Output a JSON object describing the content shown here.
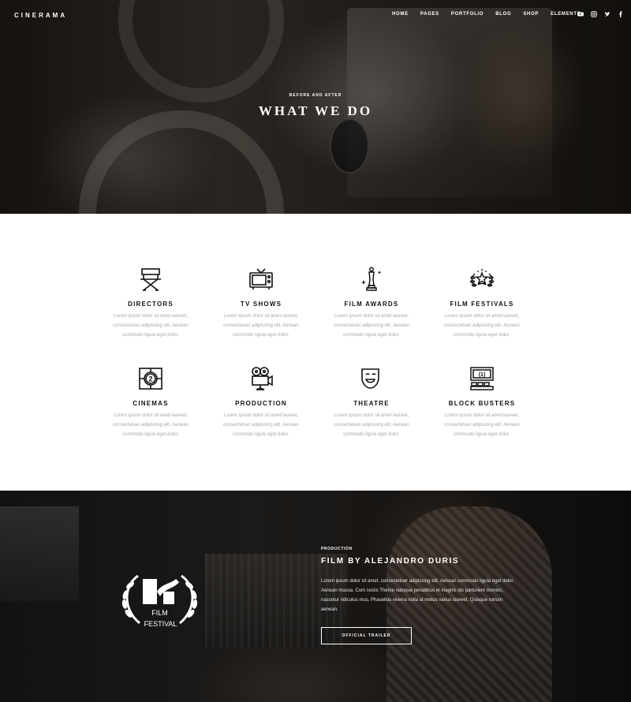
{
  "header": {
    "logo": "CINERAMA",
    "nav": [
      "HOME",
      "PAGES",
      "PORTFOLIO",
      "BLOG",
      "SHOP",
      "ELEMENTS"
    ],
    "socials": [
      "youtube-icon",
      "instagram-icon",
      "twitter-icon",
      "facebook-icon"
    ]
  },
  "hero": {
    "subtitle": "BEFORE AND AFTER",
    "title": "WHAT WE DO"
  },
  "services": {
    "items": [
      {
        "icon": "directors-chair-icon",
        "title": "DIRECTORS",
        "line1": "Lorem ipsum dolor sit amet laoreet,",
        "line2": "consectetuer adipiscing elit. Aenean",
        "line3": "commodo ligula eget dolor."
      },
      {
        "icon": "tv-icon",
        "title": "TV SHOWS",
        "line1": "Lorem ipsum dolor sit amet laoreet,",
        "line2": "consectetuer adipiscing elit. Aenean",
        "line3": "commodo ligula eget dolor."
      },
      {
        "icon": "oscar-statue-icon",
        "title": "FILM AWARDS",
        "line1": "Lorem ipsum dolor sit amet laoreet,",
        "line2": "consectetuer adipiscing elit. Aenean",
        "line3": "commodo ligula eget dolor."
      },
      {
        "icon": "laurel-star-icon",
        "title": "FILM FESTIVALS",
        "line1": "Lorem ipsum dolor sit amet laoreet,",
        "line2": "consectetuer adipiscing elit. Aenean",
        "line3": "commodo ligula eget dolor."
      },
      {
        "icon": "film-countdown-icon",
        "title": "CINEMAS",
        "line1": "Lorem ipsum dolor sit amet laoreet,",
        "line2": "consectetuer adipiscing elit. Aenean",
        "line3": "commodo ligula eget dolor."
      },
      {
        "icon": "movie-camera-icon",
        "title": "PRODUCTION",
        "line1": "Lorem ipsum dolor sit amet laoreet,",
        "line2": "consectetuer adipiscing elit. Aenean",
        "line3": "commodo ligula eget dolor."
      },
      {
        "icon": "theatre-masks-icon",
        "title": "THEATRE",
        "line1": "Lorem ipsum dolor sit amet laoreet,",
        "line2": "consectetuer adipiscing elit. Aenean",
        "line3": "commodo ligula eget dolor."
      },
      {
        "icon": "cinema-screen-seats-icon",
        "title": "BLOCK BUSTERS",
        "line1": "Lorem ipsum dolor sit amet laoreet,",
        "line2": "consectetuer adipiscing elit. Aenean",
        "line3": "commodo ligula eget dolor."
      }
    ]
  },
  "production": {
    "badge_line1": "FILM",
    "badge_line2": "FESTIVAL",
    "subtitle": "PRODUCTION",
    "title": "FILM BY ALEJANDRO DURIS",
    "text": "Lorem ipsum dolor sit amet, consectetuer adipiscing elit. Aenean commodo ligula eget dolor. Aenean massa. Cum sociis Theme natoque penatibus et magnis dis parturient montes, nascetur ridiculus mus. Phasellus viverra nulla ut metus varius laoreet. Quisque rutrum aenean.",
    "button": "OFFICIAL TRAILER"
  }
}
